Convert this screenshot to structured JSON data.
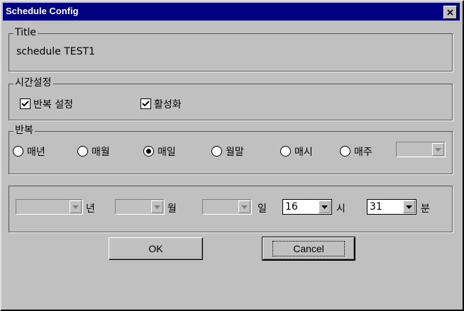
{
  "window": {
    "title": "Schedule Config",
    "close_icon": "close-icon"
  },
  "title_group": {
    "legend": "Title",
    "value": "schedule TEST1"
  },
  "time_group": {
    "legend": "시간설정",
    "checkboxes": [
      {
        "label": "반복 설정",
        "checked": true
      },
      {
        "label": "활성화",
        "checked": true
      }
    ]
  },
  "repeat_group": {
    "legend": "반복",
    "options": [
      {
        "label": "매년",
        "selected": false
      },
      {
        "label": "매월",
        "selected": false
      },
      {
        "label": "매일",
        "selected": true
      },
      {
        "label": "월말",
        "selected": false
      },
      {
        "label": "매시",
        "selected": false
      },
      {
        "label": "매주",
        "selected": false
      }
    ]
  },
  "datetime_group": {
    "year_label": "년",
    "month_label": "월",
    "day_label": "일",
    "hour_value": "16",
    "hour_label": "시",
    "minute_value": "31",
    "minute_label": "분"
  },
  "buttons": {
    "ok": "OK",
    "cancel": "Cancel"
  }
}
